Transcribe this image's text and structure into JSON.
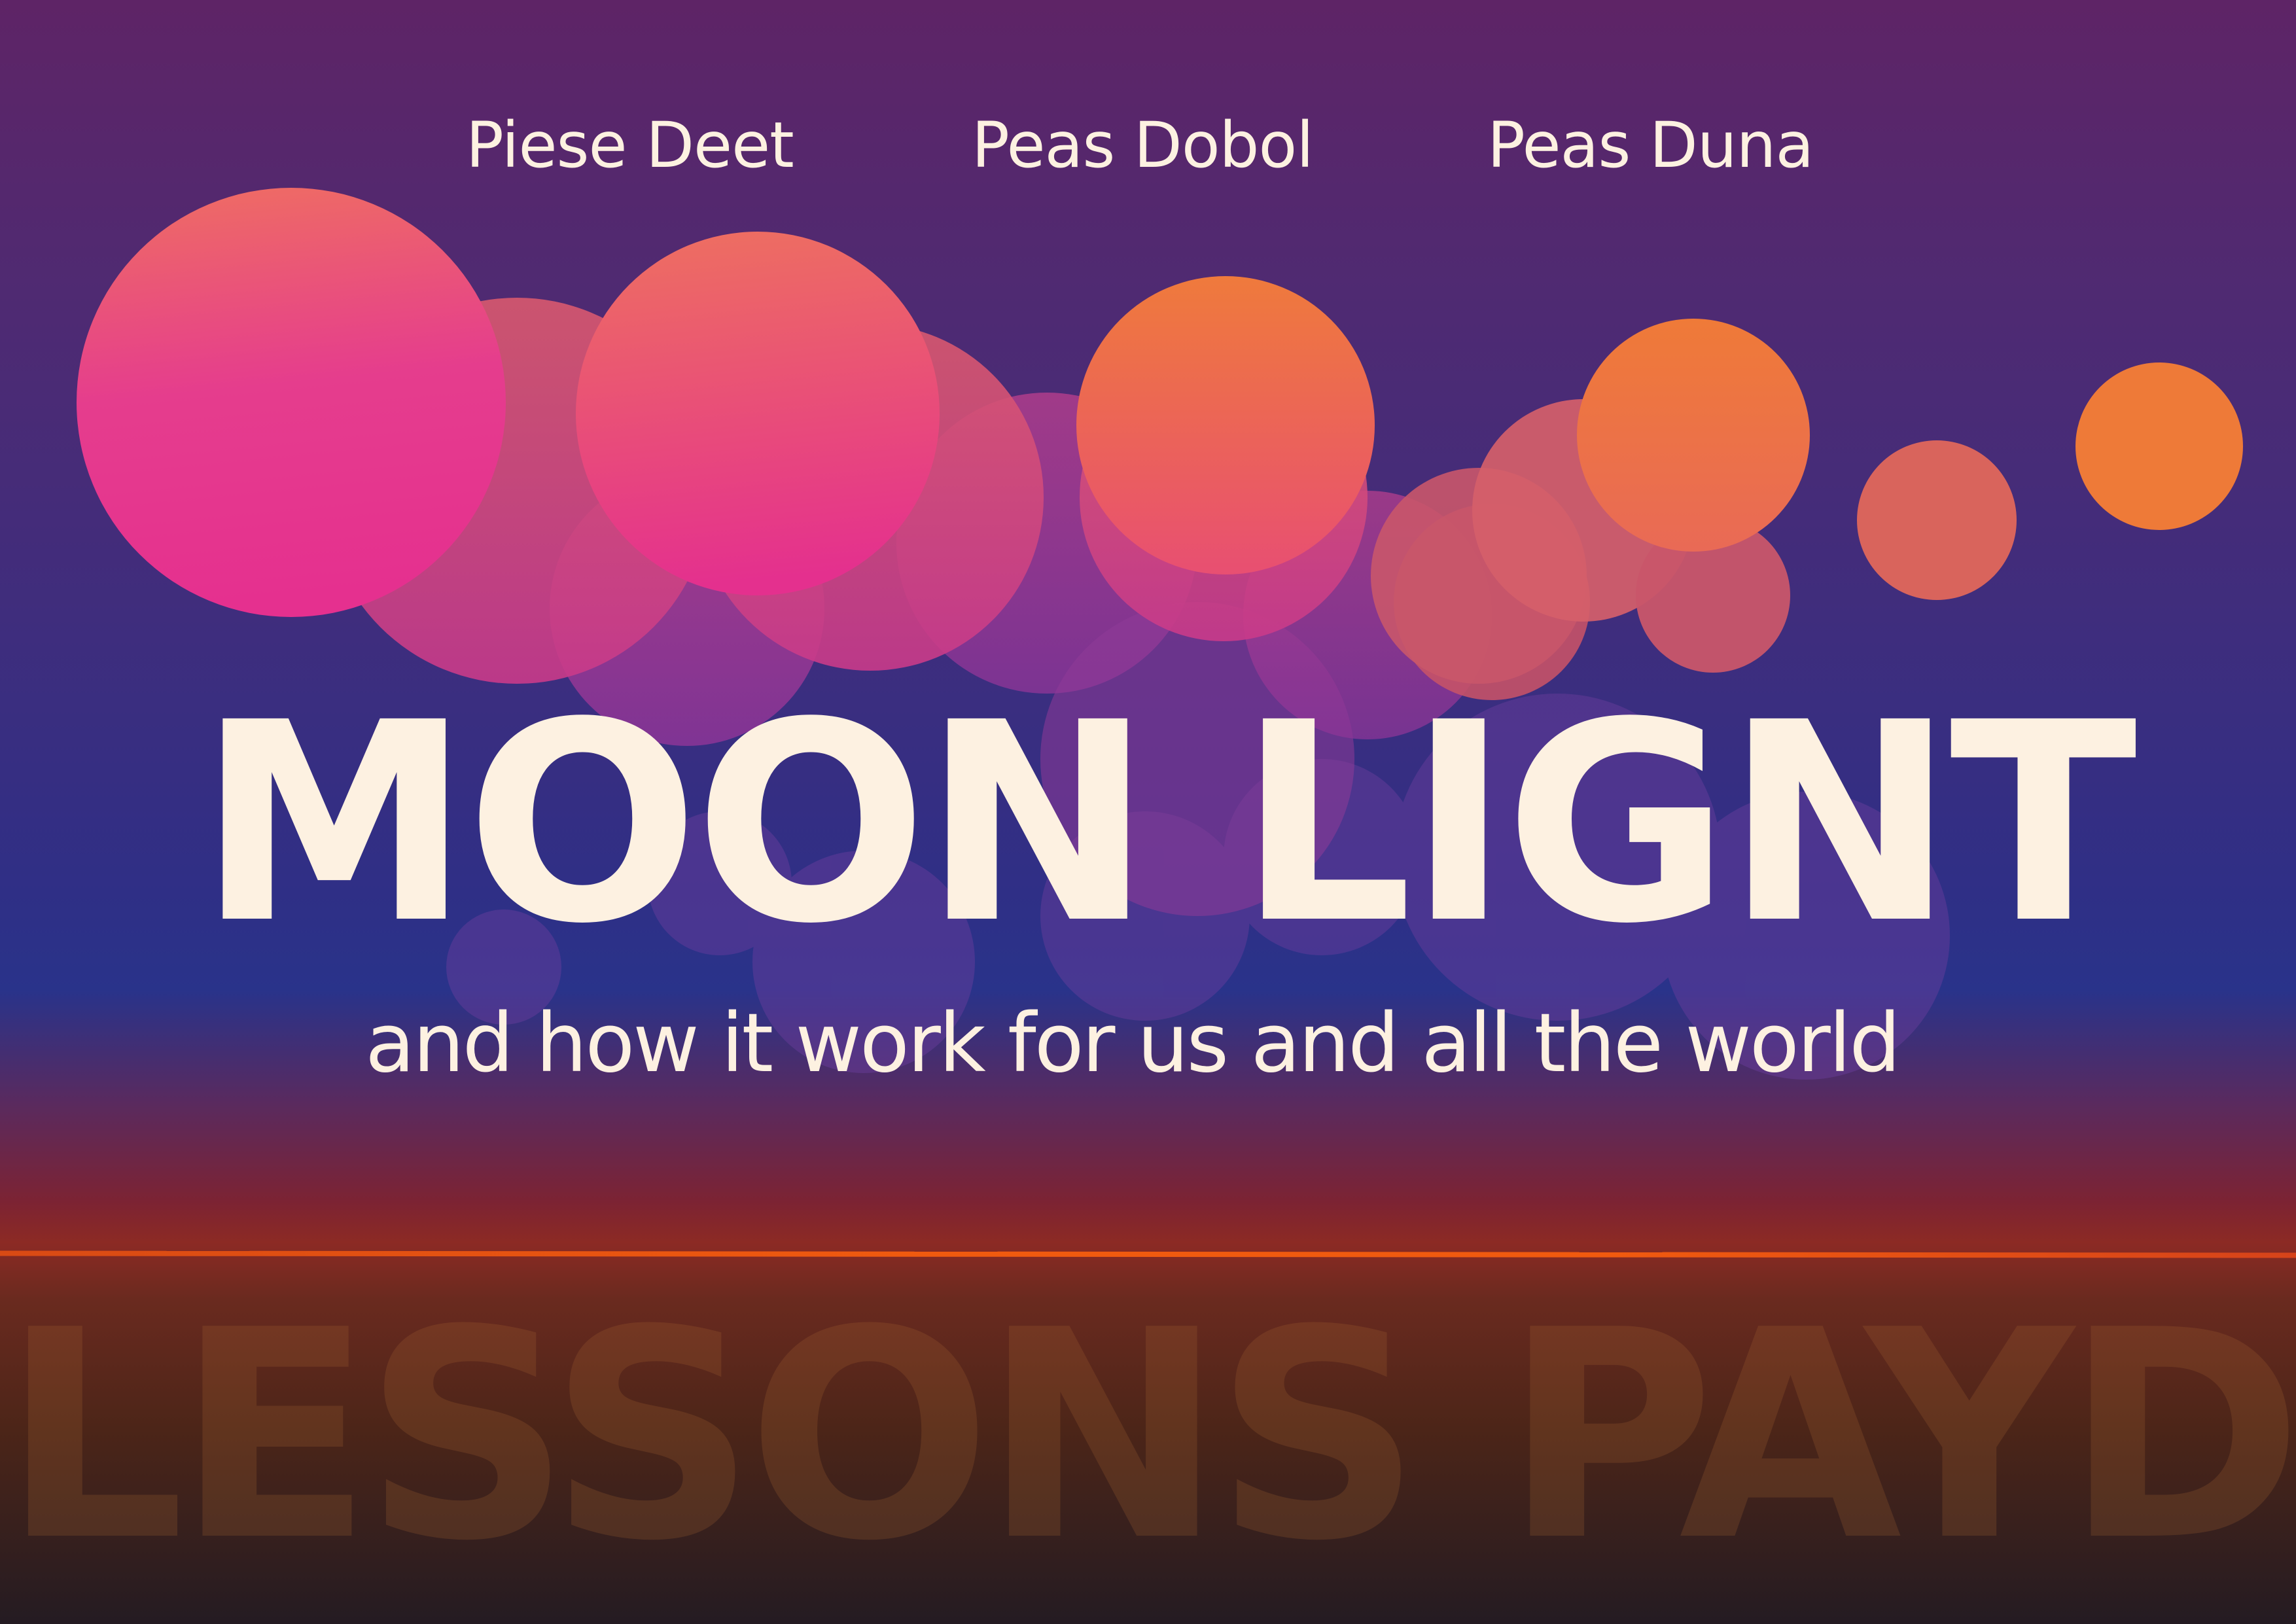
{
  "authors": [
    "Piese Deet",
    "Peas Dobol",
    "Peas Duna"
  ],
  "title": "MOON LIGNT",
  "subtitle": "and how it work for us and all the world",
  "watermark": "LESSONS PAYD",
  "colors": {
    "text": "#fdf1e1",
    "bubble_pink": "#e5308f",
    "bubble_orange": "#ef7a39",
    "horizon": "#f05a0f",
    "sky_top": "#5e2466",
    "sky_mid": "#29338a",
    "ground": "#4c2518"
  }
}
